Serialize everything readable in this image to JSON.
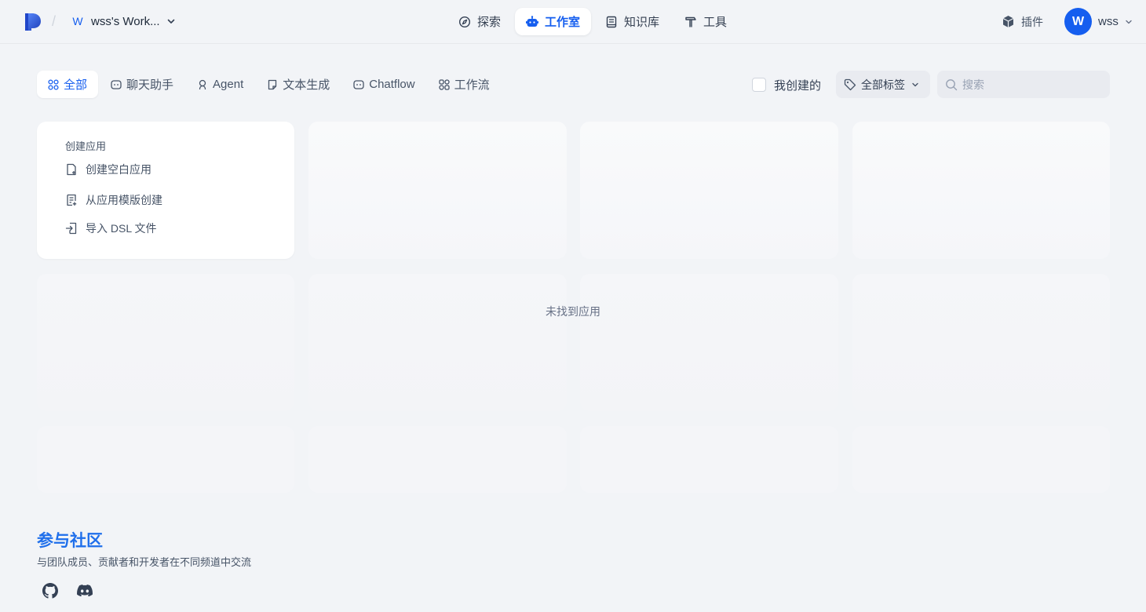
{
  "header": {
    "workspace": {
      "badge": "W",
      "name": "wss's Work..."
    },
    "nav": [
      {
        "label": "探索",
        "icon": "compass-icon"
      },
      {
        "label": "工作室",
        "icon": "robot-icon",
        "active": true
      },
      {
        "label": "知识库",
        "icon": "book-icon"
      },
      {
        "label": "工具",
        "icon": "hammer-icon"
      }
    ],
    "plugins_label": "插件",
    "user": {
      "initial": "W",
      "name": "wss"
    }
  },
  "filters": {
    "tabs": [
      {
        "label": "全部",
        "icon": "grid-icon",
        "active": true
      },
      {
        "label": "聊天助手",
        "icon": "chat-icon"
      },
      {
        "label": "Agent",
        "icon": "agent-icon"
      },
      {
        "label": "文本生成",
        "icon": "document-icon"
      },
      {
        "label": "Chatflow",
        "icon": "chatflow-icon"
      },
      {
        "label": "工作流",
        "icon": "workflow-icon"
      }
    ],
    "my_created_label": "我创建的",
    "my_created_checked": false,
    "tag_filter_label": "全部标签",
    "search_placeholder": "搜索",
    "search_value": ""
  },
  "create_card": {
    "title": "创建应用",
    "items": [
      {
        "label": "创建空白应用",
        "icon": "file-plus-icon"
      },
      {
        "label": "从应用模版创建",
        "icon": "template-icon"
      },
      {
        "label": "导入 DSL 文件",
        "icon": "import-icon"
      }
    ]
  },
  "empty_state": "未找到应用",
  "footer": {
    "title": "参与社区",
    "description": "与团队成员、贡献者和开发者在不同频道中交流",
    "links": [
      "github-icon",
      "discord-icon"
    ]
  },
  "colors": {
    "accent": "#155eef",
    "background": "#f2f4f7",
    "community_title": "#1f6feb"
  }
}
